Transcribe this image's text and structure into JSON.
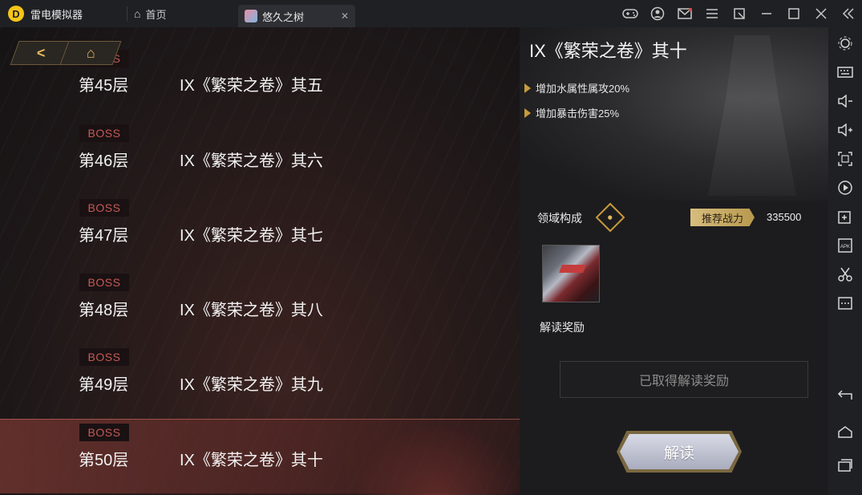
{
  "titlebar": {
    "app_name": "雷电模拟器",
    "home_tab": "首页",
    "game_tab": "悠久之树",
    "close_glyph": "✕"
  },
  "nav": {
    "back_glyph": "<",
    "home_glyph": "⌂"
  },
  "levels": [
    {
      "boss": "BOSS",
      "floor": "第45层",
      "name": "IX《繁荣之卷》其五",
      "selected": false
    },
    {
      "boss": "BOSS",
      "floor": "第46层",
      "name": "IX《繁荣之卷》其六",
      "selected": false
    },
    {
      "boss": "BOSS",
      "floor": "第47层",
      "name": "IX《繁荣之卷》其七",
      "selected": false
    },
    {
      "boss": "BOSS",
      "floor": "第48层",
      "name": "IX《繁荣之卷》其八",
      "selected": false
    },
    {
      "boss": "BOSS",
      "floor": "第49层",
      "name": "IX《繁荣之卷》其九",
      "selected": false
    },
    {
      "boss": "BOSS",
      "floor": "第50层",
      "name": "IX《繁荣之卷》其十",
      "selected": true
    }
  ],
  "detail": {
    "title": "IX《繁荣之卷》其十",
    "buffs": [
      "增加水属性属攻20%",
      "增加暴击伤害25%"
    ],
    "domain_label": "领域构成",
    "power_label": "推荐战力",
    "power_value": "335500",
    "reward_label": "解读奖励",
    "claimed_text": "已取得解读奖励",
    "read_button": "解读"
  },
  "icons": {
    "window": [
      "gamepad-icon",
      "user-icon",
      "mail-icon",
      "menu-icon",
      "external-icon",
      "minimize-icon",
      "maximize-icon",
      "close-icon",
      "collapse-icon"
    ],
    "sidebar": [
      "settings-icon",
      "keyboard-icon",
      "volume-down-icon",
      "volume-up-icon",
      "fullscreen-icon",
      "record-icon",
      "add-window-icon",
      "apk-icon",
      "scissors-icon",
      "more-icon",
      "back-icon",
      "home-icon",
      "recents-icon"
    ]
  },
  "colors": {
    "accent_gold": "#c99b3c",
    "boss_red": "#c55a55",
    "selected_row": "#78373a"
  }
}
